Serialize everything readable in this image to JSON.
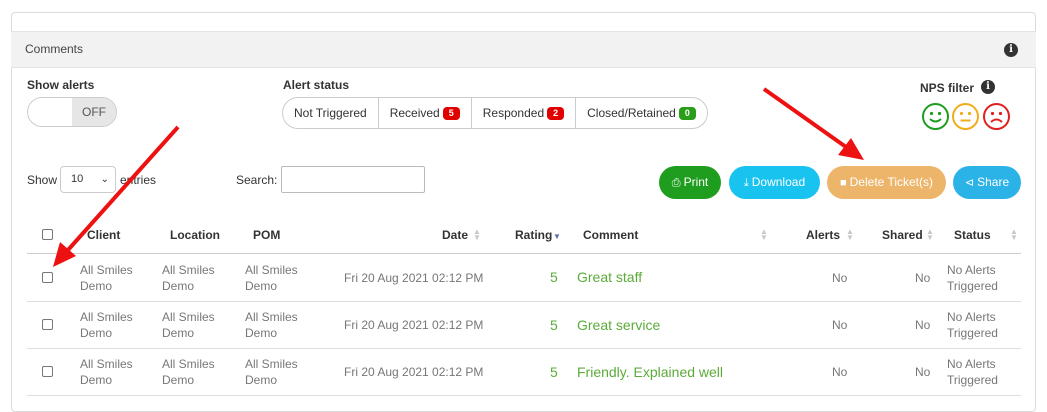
{
  "panel": {
    "title": "Comments"
  },
  "filters": {
    "show_alerts_label": "Show alerts",
    "toggle_state": "OFF",
    "alert_status_label": "Alert status",
    "statuses": [
      {
        "label": "Not Triggered",
        "count": null
      },
      {
        "label": "Received",
        "count": "5",
        "badge_color": "#e00000"
      },
      {
        "label": "Responded",
        "count": "2",
        "badge_color": "#e00000"
      },
      {
        "label": "Closed/Retained",
        "count": "0",
        "badge_color": "#2a9d1a"
      }
    ],
    "nps_filter_label": "NPS filter",
    "nps_faces": [
      {
        "icon": "smile-face-icon",
        "color": "#1e9d1e"
      },
      {
        "icon": "neutral-face-icon",
        "color": "#f0ad1a"
      },
      {
        "icon": "sad-face-icon",
        "color": "#e02020"
      }
    ]
  },
  "table_controls": {
    "show_label": "Show",
    "page_size": "10",
    "entries_label": "entries",
    "search_label": "Search:",
    "search_value": ""
  },
  "buttons": {
    "print": {
      "label": "Print",
      "color": "#1e9d1e"
    },
    "download": {
      "label": "Download",
      "color": "#18c3f0"
    },
    "delete": {
      "label": "Delete Ticket(s)",
      "color": "#ecb56a"
    },
    "share": {
      "label": "Share",
      "color": "#2bb3e8"
    }
  },
  "table": {
    "columns": [
      "Client",
      "Location",
      "POM",
      "Date",
      "Rating",
      "Comment",
      "Alerts",
      "Shared",
      "Status"
    ],
    "rows": [
      {
        "client": "All Smiles Demo",
        "client_l1": "All Smiles",
        "client_l2": "Demo",
        "location_l1": "All Smiles",
        "location_l2": "Demo",
        "pom_l1": "All Smiles",
        "pom_l2": "Demo",
        "date": "Fri 20 Aug 2021 02:12 PM",
        "rating": "5",
        "comment": "Great staff",
        "alerts": "No",
        "shared": "No",
        "status_l1": "No Alerts",
        "status_l2": "Triggered"
      },
      {
        "client": "All Smiles Demo",
        "client_l1": "All Smiles",
        "client_l2": "Demo",
        "location_l1": "All Smiles",
        "location_l2": "Demo",
        "pom_l1": "All Smiles",
        "pom_l2": "Demo",
        "date": "Fri 20 Aug 2021 02:12 PM",
        "rating": "5",
        "comment": "Great service",
        "alerts": "No",
        "shared": "No",
        "status_l1": "No Alerts",
        "status_l2": "Triggered"
      },
      {
        "client": "All Smiles Demo",
        "client_l1": "All Smiles",
        "client_l2": "Demo",
        "location_l1": "All Smiles",
        "location_l2": "Demo",
        "pom_l1": "All Smiles",
        "pom_l2": "Demo",
        "date": "Fri 20 Aug 2021 02:12 PM",
        "rating": "5",
        "comment": "Friendly. Explained well",
        "alerts": "No",
        "shared": "No",
        "status_l1": "No Alerts",
        "status_l2": "Triggered"
      }
    ]
  },
  "annotation_color": "#ee1111"
}
